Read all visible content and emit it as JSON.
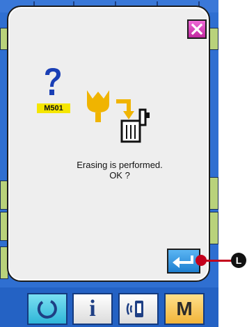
{
  "dialog": {
    "message_code": "M501",
    "message_line1": "Erasing is performed.",
    "message_line2": "OK ?",
    "close_icon": "close-x-icon",
    "enter_icon": "enter-return-icon",
    "status_icon": "question-mark-icon",
    "graphic_icon": "erase-to-trash-icon"
  },
  "callout": {
    "marker": "L"
  },
  "toolbar": {
    "info_label": "i",
    "mode_label": "M",
    "reset_icon": "reset-icon",
    "comm_icon": "communication-icon"
  },
  "colors": {
    "dialog_bg": "#eeeeee",
    "close_button": "#d43ab8",
    "enter_button": "#2f8fe0",
    "code_badge": "#f5e600",
    "panel_bg": "#2f6fd1",
    "callout": "#c3001c"
  }
}
